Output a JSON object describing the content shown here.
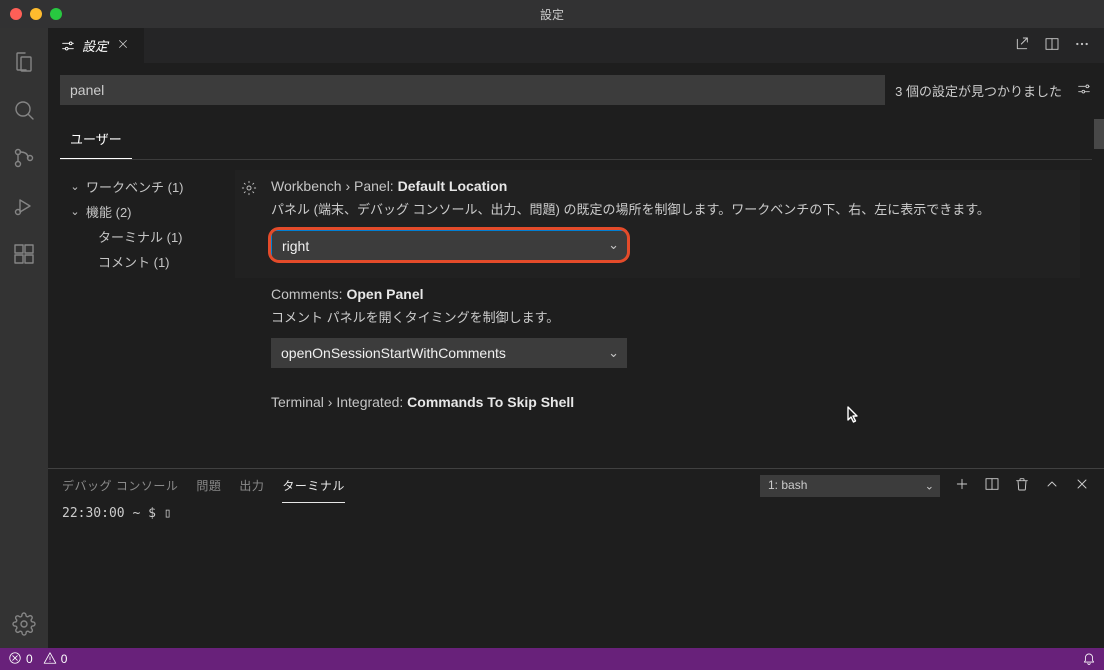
{
  "titlebar": {
    "title": "設定"
  },
  "tab": {
    "label": "設定"
  },
  "search": {
    "value": "panel",
    "result_count": "3 個の設定が見つかりました"
  },
  "scope": {
    "user": "ユーザー"
  },
  "toc": {
    "workbench": "ワークベンチ (1)",
    "features": "機能 (2)",
    "terminal": "ターミナル (1)",
    "comment": "コメント (1)"
  },
  "settings": {
    "panelLocation": {
      "category": "Workbench › Panel: ",
      "name": "Default Location",
      "desc": "パネル (端末、デバッグ コンソール、出力、問題) の既定の場所を制御します。ワークベンチの下、右、左に表示できます。",
      "value": "right"
    },
    "commentsOpenPanel": {
      "category": "Comments: ",
      "name": "Open Panel",
      "desc": "コメント パネルを開くタイミングを制御します。",
      "value": "openOnSessionStartWithComments"
    },
    "terminalSkipShell": {
      "category": "Terminal › Integrated: ",
      "name": "Commands To Skip Shell"
    }
  },
  "panel": {
    "tabs": {
      "debug": "デバッグ コンソール",
      "problems": "問題",
      "output": "出力",
      "terminal": "ターミナル"
    },
    "term_select": "1: bash",
    "prompt": "22:30:00 ~ $ ▯"
  },
  "statusbar": {
    "errors": "0",
    "warnings": "0"
  }
}
